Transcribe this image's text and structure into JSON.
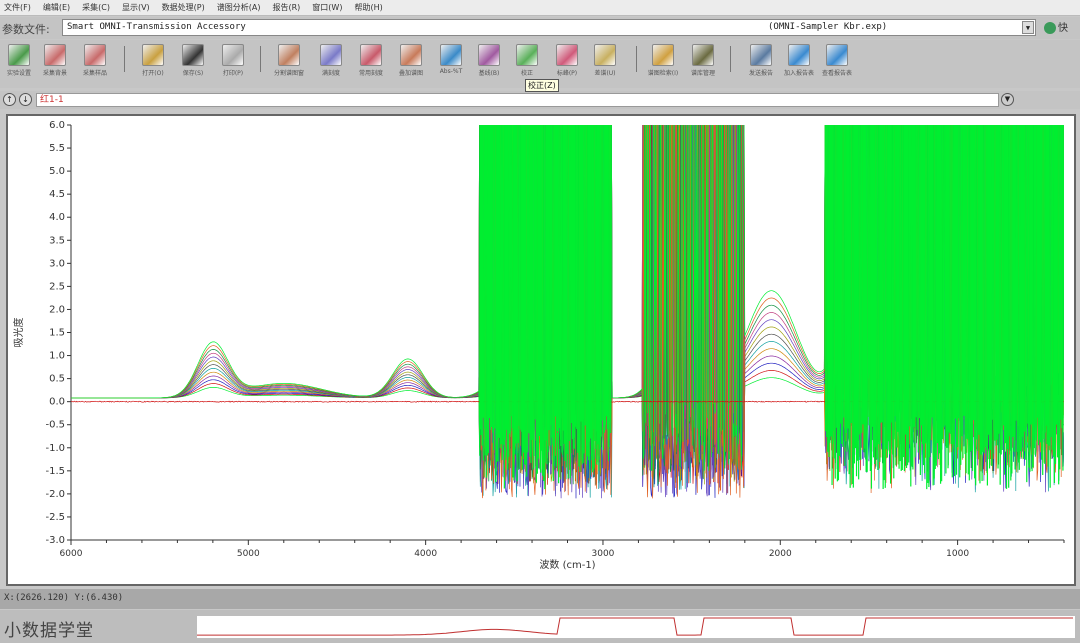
{
  "menu": [
    "文件(F)",
    "编辑(E)",
    "采集(C)",
    "显示(V)",
    "数据处理(P)",
    "谱图分析(A)",
    "报告(R)",
    "窗口(W)",
    "帮助(H)"
  ],
  "param": {
    "label": "参数文件:",
    "value": "Smart OMNI-Transmission Accessory",
    "right_value": "(OMNI-Sampler Kbr.exp)",
    "quick": "快"
  },
  "toolbar": [
    {
      "label": "实验设置",
      "icon": "experiment-setup-icon",
      "color": "#4a9a4a"
    },
    {
      "label": "采集背景",
      "icon": "collect-background-icon",
      "color": "#c86a6a"
    },
    {
      "label": "采集样品",
      "icon": "collect-sample-icon",
      "color": "#c86a6a"
    },
    {
      "label": "打开(O)",
      "icon": "open-icon",
      "color": "#c9a040"
    },
    {
      "label": "保存(S)",
      "icon": "save-icon",
      "color": "#333333"
    },
    {
      "label": "打印(P)",
      "icon": "print-icon",
      "color": "#aaaaaa"
    },
    {
      "label": "分割谱图窗",
      "icon": "split-window-icon",
      "color": "#c08060"
    },
    {
      "label": "满刻度",
      "icon": "full-scale-icon",
      "color": "#7a7ac8"
    },
    {
      "label": "常用刻度",
      "icon": "common-scale-icon",
      "color": "#c85a6a"
    },
    {
      "label": "叠加谱图",
      "icon": "overlay-icon",
      "color": "#c87a5a"
    },
    {
      "label": "Abs-%T",
      "icon": "abs-t-icon",
      "color": "#3a8ac8"
    },
    {
      "label": "基线(B)",
      "icon": "baseline-icon",
      "color": "#a05aa0"
    },
    {
      "label": "校正",
      "icon": "correct-icon",
      "color": "#5ab05a"
    },
    {
      "label": "标峰(P)",
      "icon": "peak-label-icon",
      "color": "#d05a7a"
    },
    {
      "label": "差谱(U)",
      "icon": "subtract-icon",
      "color": "#c8b060"
    },
    {
      "label": "谱图检索(I)",
      "icon": "library-search-icon",
      "color": "#d0a040"
    },
    {
      "label": "谱库管理",
      "icon": "library-manage-icon",
      "color": "#6a6a40"
    },
    {
      "label": "发送报告",
      "icon": "send-report-icon",
      "color": "#5a7aa0"
    },
    {
      "label": "加入报告表",
      "icon": "add-report-icon",
      "color": "#3a8ad0"
    },
    {
      "label": "查看报告表",
      "icon": "view-report-icon",
      "color": "#3a8ad0"
    }
  ],
  "tooltip": "校正(Z)",
  "spectrum": {
    "name": "红1-1"
  },
  "status": "X:(2626.120) Y:(6.430)",
  "watermark": "小数据学堂",
  "chart_data": {
    "type": "line",
    "xlabel": "波数 (cm-1)",
    "ylabel": "吸光度",
    "xlim": [
      6000,
      400
    ],
    "ylim": [
      -3.0,
      6.0
    ],
    "xticks": [
      6000,
      5000,
      4000,
      3000,
      2000,
      1000
    ],
    "yticks": [
      6.0,
      5.5,
      5.0,
      4.5,
      4.0,
      3.5,
      3.0,
      2.5,
      2.0,
      1.5,
      1.0,
      0.5,
      0.0,
      -0.5,
      -1.0,
      -1.5,
      -2.0,
      -2.5,
      -3.0
    ],
    "series_colors": [
      "#00ee30",
      "#d01010",
      "#2020c0",
      "#8a2aa0",
      "#d08a10",
      "#10a0a0",
      "#505050",
      "#a0a010",
      "#6040c0",
      "#c04080",
      "#109040",
      "#e06020"
    ]
  }
}
